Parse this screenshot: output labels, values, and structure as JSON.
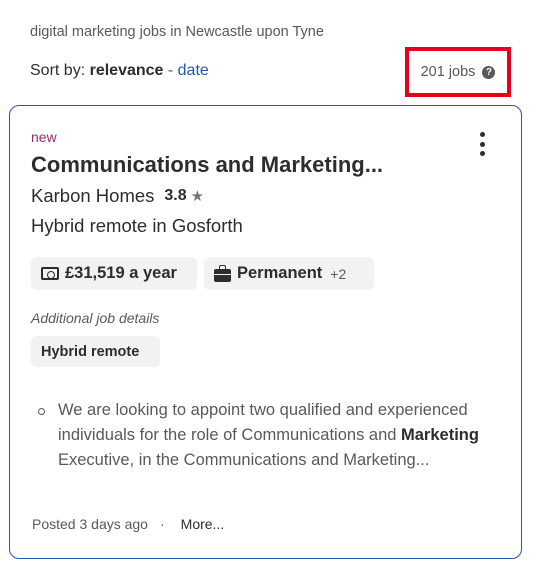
{
  "search": {
    "summary": "digital marketing jobs in Newcastle upon Tyne"
  },
  "sort": {
    "prefix": "Sort by:",
    "current": "relevance",
    "separator": " - ",
    "alternative": "date"
  },
  "results": {
    "count_label": "201 jobs",
    "help_glyph": "?"
  },
  "job": {
    "badge": "new",
    "title": "Communications and Marketing...",
    "company": "Karbon Homes",
    "rating": "3.8",
    "rating_icon": "star-icon",
    "location": "Hybrid remote in Gosforth",
    "salary": "£31,519 a year",
    "salary_icon": "salary-icon",
    "job_type": "Permanent",
    "job_type_icon": "briefcase-icon",
    "job_type_extra": "+2",
    "additional_label": "Additional job details",
    "tag": "Hybrid remote",
    "snippet_pre": "We are looking to appoint two qualified and experienced individuals for the role of Communications and ",
    "snippet_bold": "Marketing",
    "snippet_post": " Executive, in the Communications and Marketing...",
    "posted": "Posted 3 days ago",
    "dot": "·",
    "more": "More..."
  }
}
